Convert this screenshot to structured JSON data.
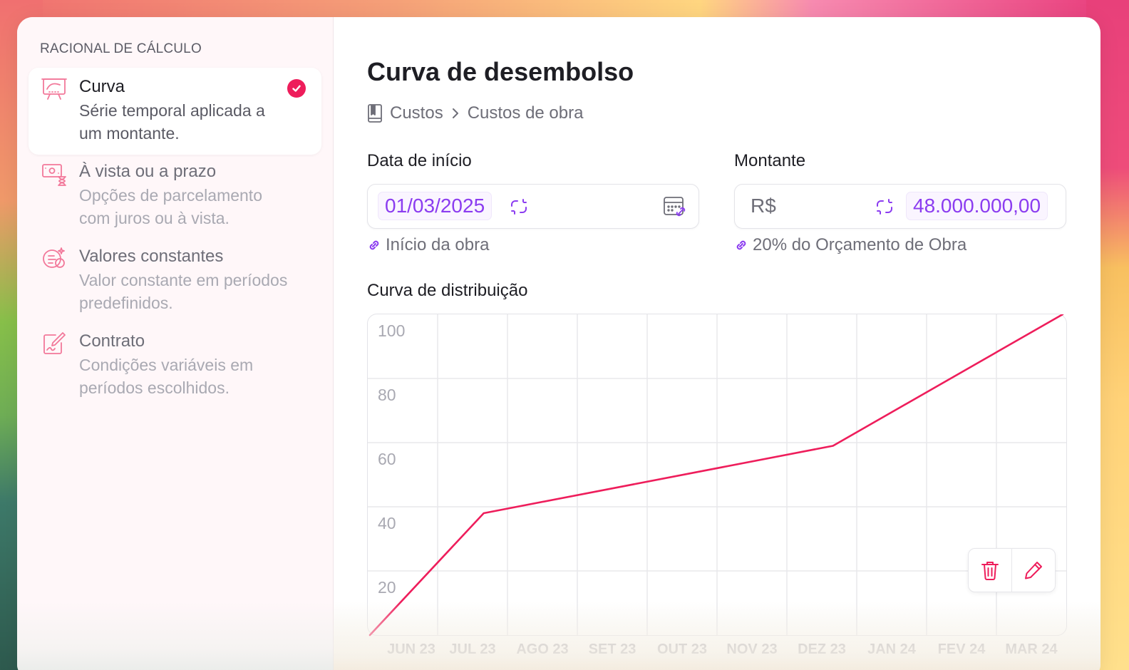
{
  "sidebar": {
    "heading": "RACIONAL DE CÁLCULO",
    "items": [
      {
        "title": "Curva",
        "desc1": "Série temporal aplicada a",
        "desc2": "um montante.",
        "icon": "presentation-chart-icon",
        "selected": true
      },
      {
        "title": "À vista ou a prazo",
        "desc1": "Opções de parcelamento",
        "desc2": "com juros ou à vista.",
        "icon": "money-hourglass-icon",
        "selected": false
      },
      {
        "title": "Valores constantes",
        "desc1": "Valor constante em períodos",
        "desc2": "predefinidos.",
        "icon": "coins-sparkle-icon",
        "selected": false
      },
      {
        "title": "Contrato",
        "desc1": "Condições variáveis em",
        "desc2": "períodos escolhidos.",
        "icon": "contract-pen-icon",
        "selected": false
      }
    ]
  },
  "main": {
    "title": "Curva de desembolso",
    "breadcrumb": [
      "Custos",
      "Custos de obra"
    ],
    "start_date": {
      "label": "Data de início",
      "value": "01/03/2025",
      "hint": "Início da obra"
    },
    "amount": {
      "label": "Montante",
      "currency": "R$",
      "value": "48.000.000,00",
      "hint": "20% do Orçamento de Obra"
    },
    "chart_label": "Curva de distribuição"
  },
  "colors": {
    "accent": "#ee1d5b",
    "linked_value": "#8b3cf0",
    "line": "#ee1d5b"
  },
  "chart_data": {
    "type": "line",
    "categories": [
      "JUN 23",
      "JUL 23",
      "AGO 23",
      "SET 23",
      "OUT 23",
      "NOV 23",
      "DEZ 23",
      "JAN 24",
      "FEV 24",
      "MAR 24"
    ],
    "x": [
      "JUN 23",
      "JUL 23",
      "DEZ 23",
      "MAR 24"
    ],
    "series": [
      {
        "values": [
          0,
          38,
          59,
          100
        ]
      }
    ],
    "yticks": [
      100,
      80,
      60,
      40,
      20
    ],
    "ylim": [
      0,
      100
    ],
    "grid": true,
    "legend": "none"
  }
}
